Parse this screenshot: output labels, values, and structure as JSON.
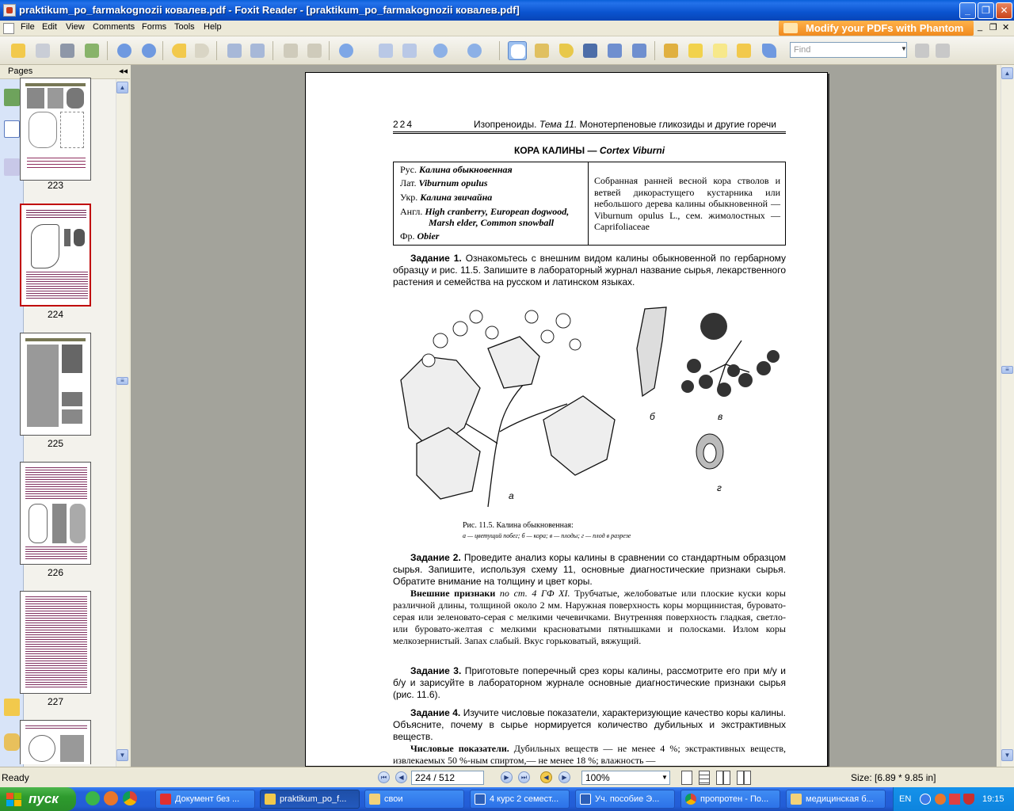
{
  "window": {
    "title": "praktikum_po_farmakognozii ковалев.pdf - Foxit Reader - [praktikum_po_farmakognozii ковалев.pdf]"
  },
  "menu": [
    "File",
    "Edit",
    "View",
    "Comments",
    "Forms",
    "Tools",
    "Help"
  ],
  "promo": "Modify your PDFs with Phantom",
  "toolbar": {
    "find_placeholder": "Find",
    "icons": [
      "open-icon",
      "save-icon",
      "print-icon",
      "email-icon",
      "prev-page-icon",
      "next-page-icon",
      "back-icon",
      "forward-icon",
      "extract-icon",
      "insert-icon",
      "undo-icon",
      "redo-icon",
      "zoom-icon",
      "fit-page-icon",
      "fit-width-icon",
      "zoom-out-icon",
      "zoom-in-icon",
      "hand-tool-icon",
      "select-text-icon",
      "select-tool-icon",
      "binoculars-icon",
      "typewriter-icon",
      "snapshot-icon",
      "edit-icon",
      "highlight-icon",
      "textbox-icon",
      "note-icon",
      "arrow-icon"
    ]
  },
  "panel": {
    "pages_label": "Pages",
    "thumbnails": [
      {
        "label": "223",
        "selected": false
      },
      {
        "label": "224",
        "selected": true
      },
      {
        "label": "225",
        "selected": false
      },
      {
        "label": "226",
        "selected": false
      },
      {
        "label": "227",
        "selected": false
      },
      {
        "label": "",
        "selected": false
      }
    ]
  },
  "document": {
    "page_number": "224",
    "running_head": "Изопреноиды.",
    "running_head_theme": "Тема 11.",
    "running_head_rest": "Монотерпеновые гликозиды и другие горечи",
    "section_title": "КОРА КАЛИНЫ —",
    "section_title_latin": "Cortex Viburni",
    "names": [
      {
        "lang": "Рус.",
        "value": "Калина обыкновенная"
      },
      {
        "lang": "Лат.",
        "value": "Viburnum opulus"
      },
      {
        "lang": "Укр.",
        "value": "Калина звичайна"
      },
      {
        "lang": "Англ.",
        "value": "High cranberry, European dogwood,"
      },
      {
        "lang": "",
        "value": "Marsh elder, Common snowball"
      },
      {
        "lang": "Фр.",
        "value": "Obier"
      }
    ],
    "description": "Собранная ранней весной кора стволов и ветвей дикорастущего кустарника или небольшого дерева калины обыкновенной — Viburnum opulus L., сем. жимолостных — Caprifoliaceae",
    "task1_lead": "Задание 1.",
    "task1": "Ознакомьтесь с внешним видом калины обыкновенной по гербарному образцу и рис. 11.5. Запишите в лабораторный журнал название сырья, лекарственного растения и семейства на русском и латинском языках.",
    "figure_labels": {
      "a": "а",
      "b": "б",
      "v": "в",
      "g": "г"
    },
    "caption": "Рис. 11.5. Калина обыкновенная:",
    "caption_detail": "а — цветущий побег; б — кора; в — плоды; г — плод в разрезе",
    "task2_lead": "Задание 2.",
    "task2": "Проведите анализ коры калины в сравнении со стандартным образцом сырья. Запишите, используя схему 11, основные диагностические признаки сырья. Обратите внимание на толщину и цвет коры.",
    "ext_lead": "Внешние признаки",
    "ext_ref": "по ст. 4 ГФ XI.",
    "ext": "Трубчатые, желобоватые или плоские куски коры различной длины, толщиной около 2 мм. Наружная поверхность коры морщинистая, буровато-серая или зеленовато-серая с мелкими чечевичками. Внутренняя поверхность гладкая, светло- или буровато-желтая с мелкими красноватыми пятнышками и полосками. Излом коры мелкозернистый. Запах слабый. Вкус горьковатый, вяжущий.",
    "task3_lead": "Задание 3.",
    "task3": "Приготовьте поперечный срез коры калины, рассмотрите его при м/у и б/у и зарисуйте в лабораторном журнале основные диагностические признаки сырья (рис. 11.6).",
    "task4_lead": "Задание 4.",
    "task4": "Изучите числовые показатели, характеризующие качество коры калины. Объясните, почему в сырье нормируется количество дубильных и экстрактивных веществ.",
    "num_lead": "Числовые показатели.",
    "num": "Дубильных веществ — не менее 4 %; экстрактивных веществ, извлекаемых 50 %-ным спиртом,— не менее 18 %; влажность —"
  },
  "status": {
    "ready": "Ready",
    "page_field": "224 / 512",
    "zoom": "100%",
    "size": "Size: [6.89 * 9.85 in]"
  },
  "taskbar": {
    "start": "пуск",
    "tasks": [
      {
        "label": "Документ без ...",
        "active": false,
        "color": "#E03030"
      },
      {
        "label": "praktikum_po_f...",
        "active": true,
        "color": "#F2C94C"
      },
      {
        "label": "свои",
        "active": false,
        "color": "#F2D27A"
      },
      {
        "label": "4 курс 2 семест...",
        "active": false,
        "color": "#2B5FB8"
      },
      {
        "label": "Уч. пособие Э...",
        "active": false,
        "color": "#2B5FB8"
      },
      {
        "label": "пропротен - По...",
        "active": false,
        "color": "#E0A030"
      },
      {
        "label": "медицинская б...",
        "active": false,
        "color": "#F2D27A"
      }
    ],
    "lang": "EN",
    "time": "19:15"
  }
}
